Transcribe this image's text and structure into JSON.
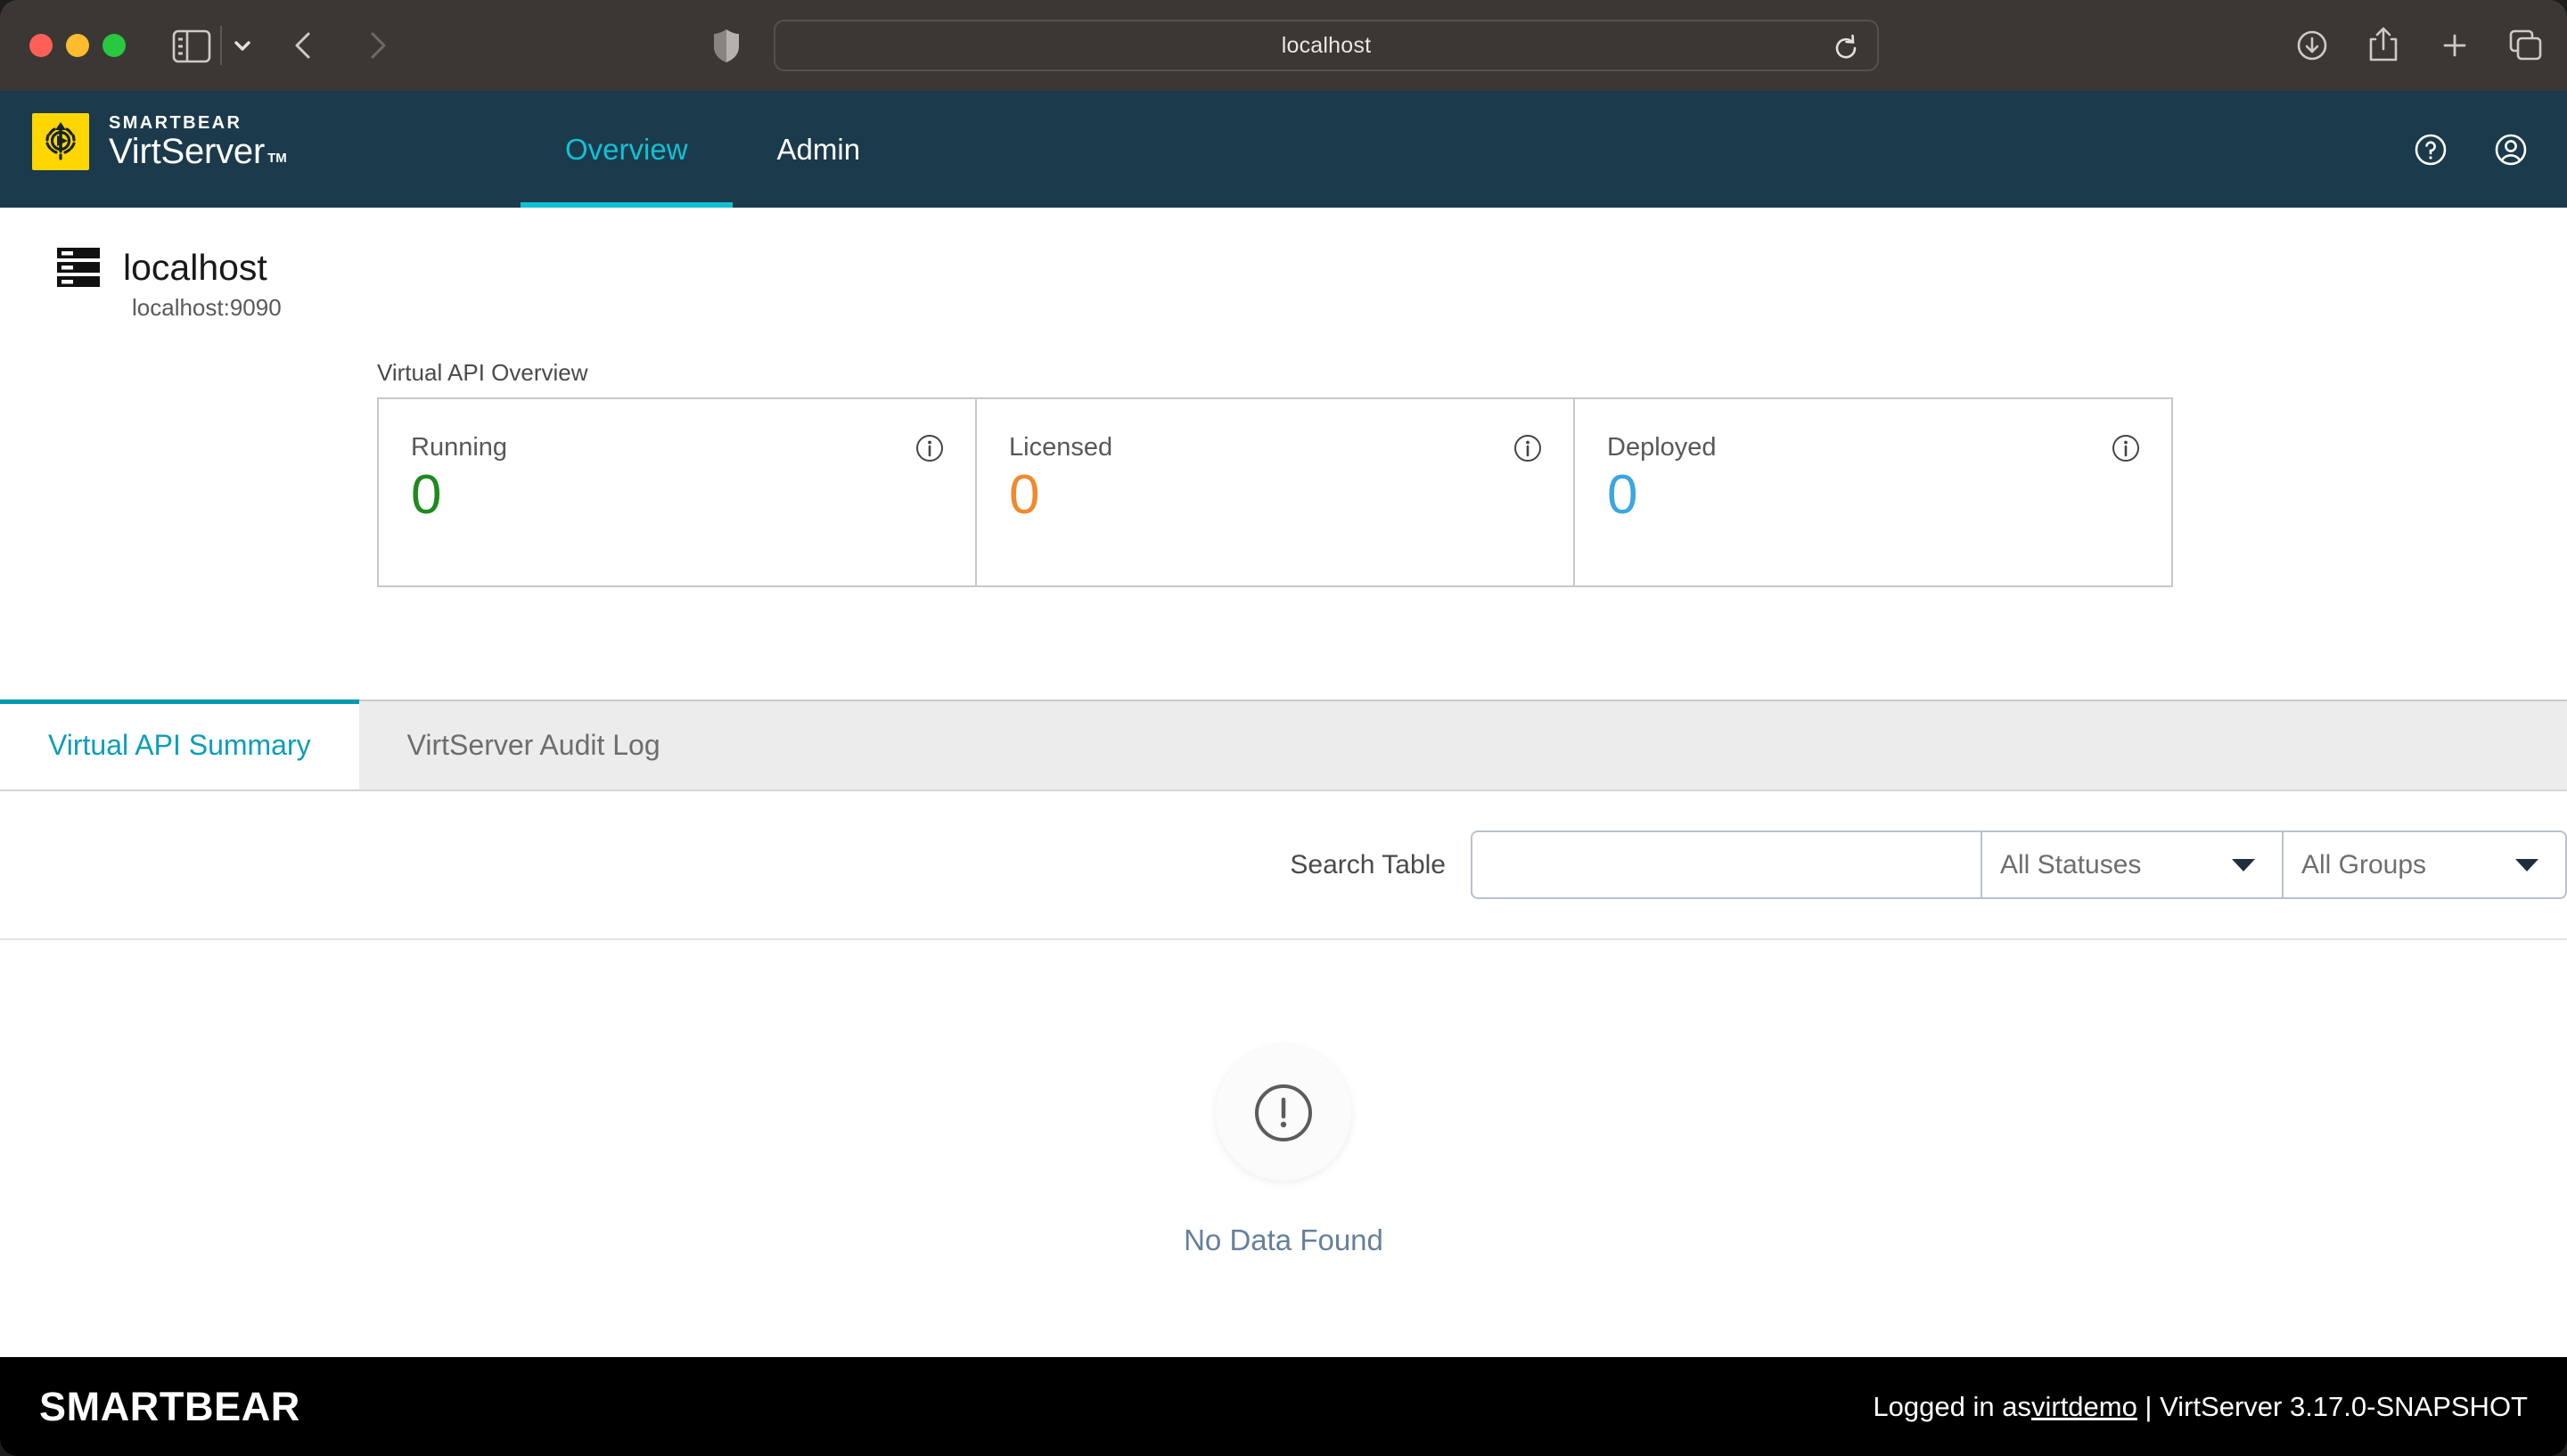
{
  "browser": {
    "url_value": "localhost",
    "icons": {
      "sidebar": "sidebar-toggle-icon",
      "sidebar_chevron": "chevron-down-icon",
      "back": "back-arrow-icon",
      "forward": "forward-arrow-icon",
      "shield": "privacy-shield-icon",
      "reload": "reload-icon",
      "download": "downloads-icon",
      "share": "share-icon",
      "new_tab": "plus-icon",
      "tab_overview": "tab-overview-icon"
    }
  },
  "header": {
    "brand_top": "SMARTBEAR",
    "brand_bottom": "VirtServer",
    "brand_tm": "TM",
    "nav": [
      {
        "label": "Overview",
        "active": true
      },
      {
        "label": "Admin",
        "active": false
      }
    ],
    "help_icon": "help-circle-icon",
    "account_icon": "user-account-icon",
    "background_color": "#1b3a4b",
    "accent_color": "#12c0d4"
  },
  "server": {
    "icon": "server-stack-icon",
    "name": "localhost",
    "host": "localhost:9090"
  },
  "overview": {
    "label": "Virtual API Overview",
    "cards": [
      {
        "label": "Running",
        "value": "0",
        "color": "#1f8a1f",
        "info_icon": "info-circle-icon"
      },
      {
        "label": "Licensed",
        "value": "0",
        "color": "#ee8b2d",
        "info_icon": "info-circle-icon"
      },
      {
        "label": "Deployed",
        "value": "0",
        "color": "#3ba7e0",
        "info_icon": "info-circle-icon"
      }
    ]
  },
  "content_tabs": [
    {
      "label": "Virtual API Summary",
      "active": true
    },
    {
      "label": "VirtServer Audit Log",
      "active": false
    }
  ],
  "filters": {
    "search_label": "Search Table",
    "search_value": "",
    "search_placeholder": "",
    "status_select": "All Statuses",
    "group_select": "All Groups",
    "caret_icon": "chevron-down-icon"
  },
  "empty_state": {
    "icon": "exclamation-circle-icon",
    "text": "No Data Found"
  },
  "footer": {
    "brand": "SMARTBEAR",
    "logged_in_prefix": "Logged in as ",
    "user": "virtdemo",
    "separator": " | ",
    "version": "VirtServer 3.17.0-SNAPSHOT"
  }
}
